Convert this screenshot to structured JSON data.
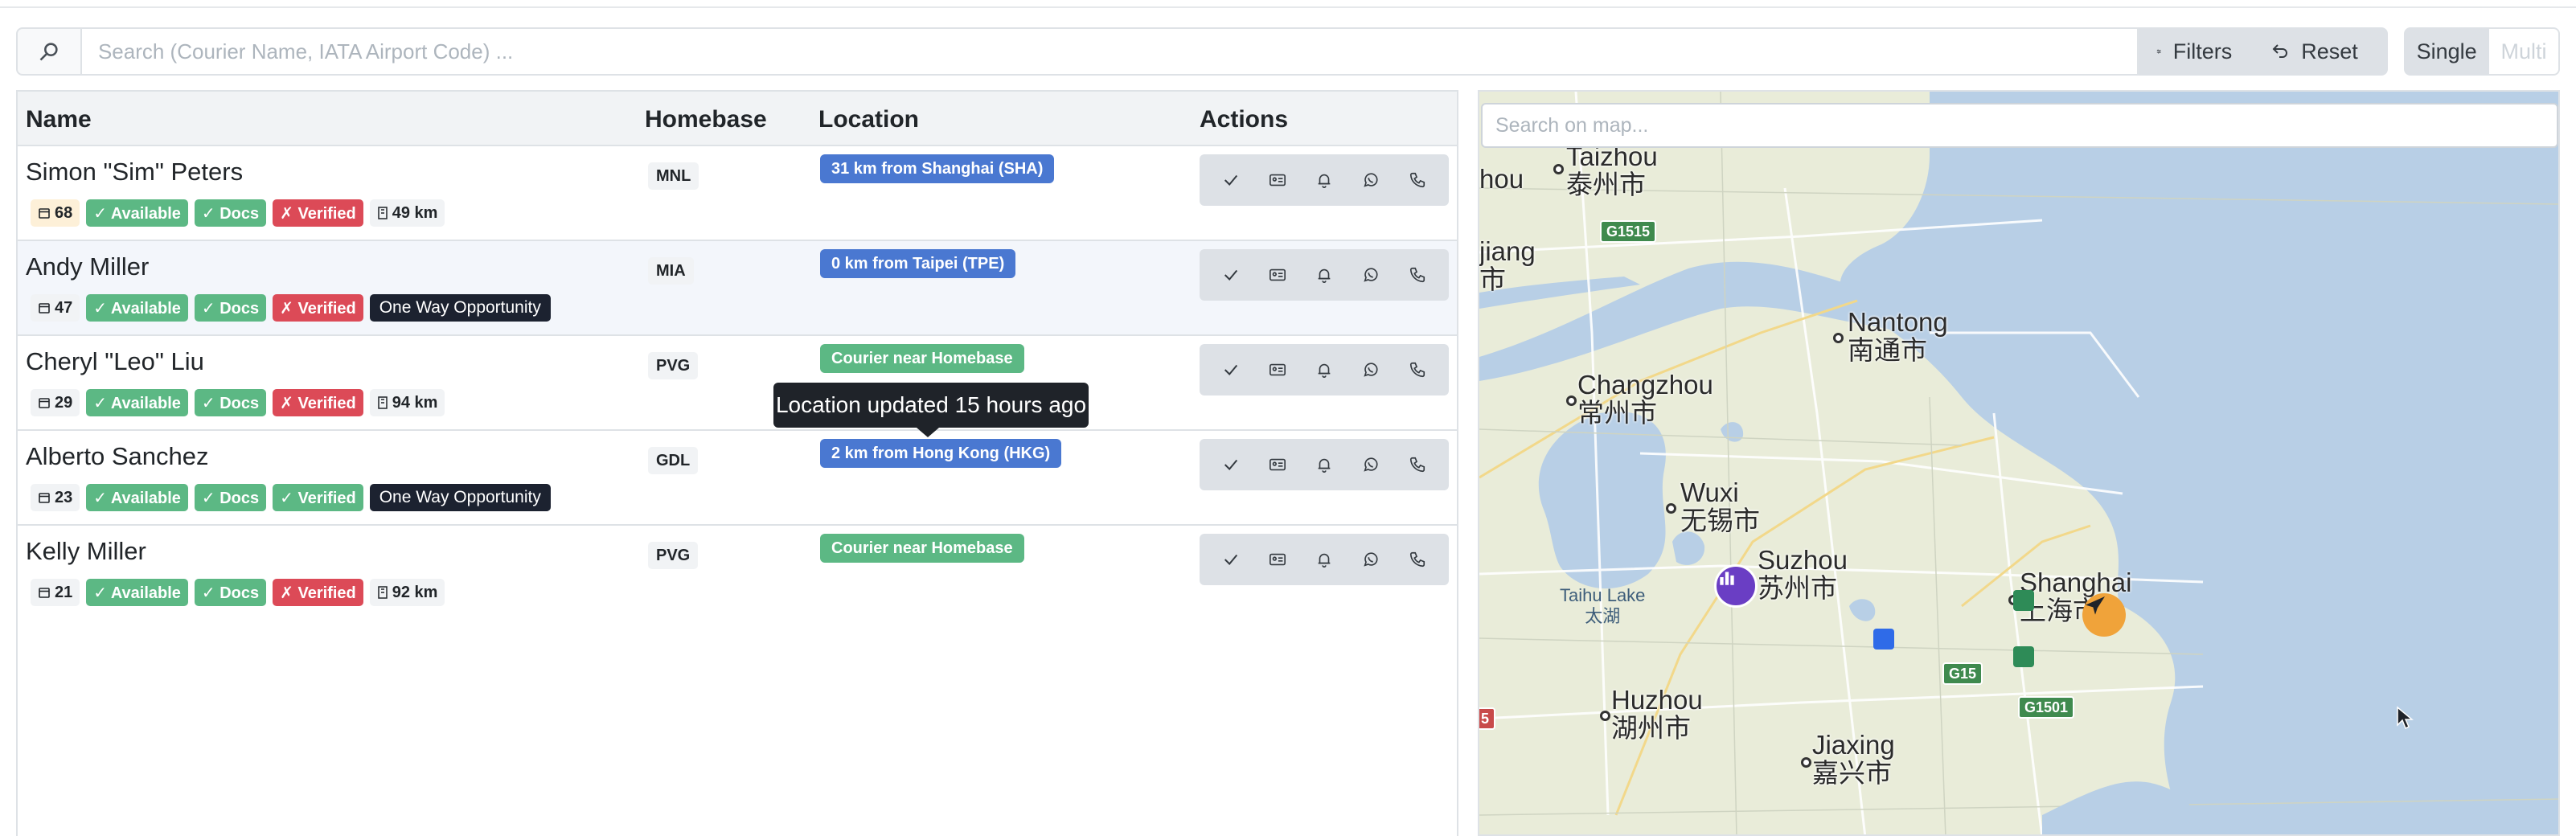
{
  "search": {
    "placeholder": "Search (Courier Name, IATA Airport Code) ...",
    "filters_label": "Filters",
    "reset_label": "Reset",
    "single_label": "Single",
    "multi_label": "Multi"
  },
  "table": {
    "headers": {
      "name": "Name",
      "homebase": "Homebase",
      "location": "Location",
      "actions": "Actions"
    },
    "rows": [
      {
        "name": "Simon \"Sim\" Peters",
        "count": "68",
        "available": "✓ Available",
        "docs": "✓ Docs",
        "verified": "✗ Verified",
        "extra": "49 km",
        "homebase": "MNL",
        "location": "31 km from Shanghai (SHA)"
      },
      {
        "name": "Andy Miller",
        "count": "47",
        "available": "✓ Available",
        "docs": "✓ Docs",
        "verified": "✗ Verified",
        "extra": "One Way Opportunity",
        "homebase": "MIA",
        "location": "0 km from Taipei (TPE)"
      },
      {
        "name": "Cheryl \"Leo\" Liu",
        "count": "29",
        "available": "✓ Available",
        "docs": "✓ Docs",
        "verified": "✗ Verified",
        "extra": "94 km",
        "homebase": "PVG",
        "location": "Courier near Homebase"
      },
      {
        "name": "Alberto Sanchez",
        "count": "23",
        "available": "✓ Available",
        "docs": "✓ Docs",
        "verified": "✓ Verified",
        "extra": "One Way Opportunity",
        "homebase": "GDL",
        "location": "2 km from Hong Kong (HKG)"
      },
      {
        "name": "Kelly Miller",
        "count": "21",
        "available": "✓ Available",
        "docs": "✓ Docs",
        "verified": "✗ Verified",
        "extra": "92 km",
        "homebase": "PVG",
        "location": "Courier near Homebase"
      }
    ]
  },
  "tooltip": {
    "text": "Location updated 15 hours ago"
  },
  "map": {
    "search_placeholder": "Search on map...",
    "cities": {
      "taizhou": {
        "en": "Taizhou",
        "zh": "泰州市"
      },
      "nantong": {
        "en": "Nantong",
        "zh": "南通市"
      },
      "changzhou": {
        "en": "Changzhou",
        "zh": "常州市"
      },
      "wuxi": {
        "en": "Wuxi",
        "zh": "无锡市"
      },
      "suzhou": {
        "en": "Suzhou",
        "zh": "苏州市"
      },
      "shanghai": {
        "en": "Shanghai",
        "zh": "上海市"
      },
      "huzhou": {
        "en": "Huzhou",
        "zh": "湖州市"
      },
      "jiaxing": {
        "en": "Jiaxing",
        "zh": "嘉兴市"
      },
      "left1": "hou",
      "left2": "jiang",
      "left3": "市"
    },
    "lake": {
      "en": "Taihu Lake",
      "zh": "太湖"
    },
    "shields": {
      "g1515": "G1515",
      "g15": "G15",
      "g1501": "G1501",
      "partial": "5"
    }
  },
  "colors": {
    "available": "#5cb884",
    "verified_false": "#dc4a57",
    "location_blue": "#4a78d1",
    "dark_badge": "#1c2230"
  }
}
